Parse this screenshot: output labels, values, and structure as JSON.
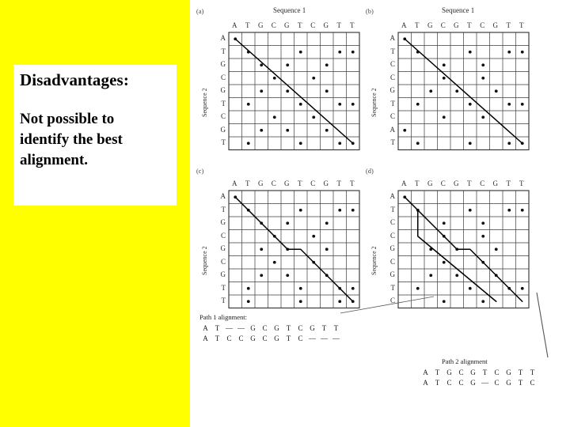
{
  "slide": {
    "background_color": "#ffff00",
    "card_background": "#ffffff",
    "title": "Disadvantages:",
    "body_line1": "Not possible to",
    "body_line2": "identify the best",
    "body_line3": "alignment."
  },
  "figure": {
    "sequence1_label": "Sequence 1",
    "sequence2_label": "Sequence 2",
    "sequence1": [
      "A",
      "T",
      "G",
      "C",
      "G",
      "T",
      "C",
      "G",
      "T",
      "T"
    ],
    "panels": [
      {
        "tag": "(a)",
        "show_seq1_title": true,
        "show_seq2_title": true,
        "sequence2": [
          "A",
          "T",
          "G",
          "C",
          "G",
          "T",
          "C",
          "G",
          "T"
        ],
        "path_kind": "straight"
      },
      {
        "tag": "(b)",
        "show_seq1_title": true,
        "show_seq2_title": true,
        "sequence2": [
          "A",
          "T",
          "C",
          "C",
          "G",
          "T",
          "C",
          "A",
          "T"
        ],
        "path_kind": "straight"
      },
      {
        "tag": "(c)",
        "show_seq1_title": false,
        "show_seq2_title": true,
        "sequence2": [
          "A",
          "T",
          "G",
          "C",
          "G",
          "C",
          "G",
          "T",
          "T"
        ],
        "path_kind": "jog"
      },
      {
        "tag": "(d)",
        "show_seq1_title": false,
        "show_seq2_title": true,
        "sequence2": [
          "A",
          "T",
          "C",
          "C",
          "G",
          "C",
          "G",
          "T",
          "C"
        ],
        "path_kind": "two-paths"
      }
    ],
    "path1": {
      "label": "Path 1 alignment:",
      "top": [
        "A",
        "T",
        "—",
        "—",
        "G",
        "C",
        "G",
        "T",
        "C",
        "G",
        "T",
        "T"
      ],
      "bottom": [
        "A",
        "T",
        "C",
        "C",
        "G",
        "C",
        "G",
        "T",
        "C",
        "—",
        "—",
        "—"
      ]
    },
    "path2": {
      "label": "Path 2 alignment",
      "top": [
        "A",
        "T",
        "G",
        "C",
        "G",
        "T",
        "C",
        "G",
        "T",
        "T"
      ],
      "bottom": [
        "A",
        "T",
        "C",
        "C",
        "G",
        "—",
        "C",
        "G",
        "T",
        "C"
      ]
    }
  }
}
